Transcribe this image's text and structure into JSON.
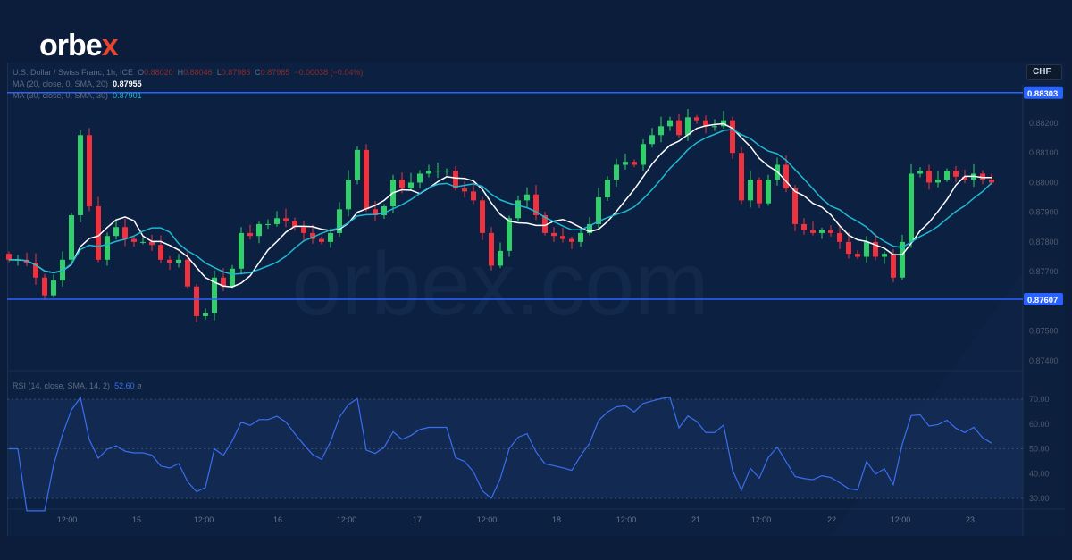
{
  "brand": {
    "logo": "orbex",
    "watermark": "orbex.com"
  },
  "legend": {
    "symbol": "U.S. Dollar / Swiss Franc, 1h, ICE",
    "o_label": "O",
    "o": "0.88020",
    "h_label": "H",
    "h": "0.88046",
    "l_label": "L",
    "l": "0.87985",
    "c_label": "C",
    "c": "0.87985",
    "change": "−0.00038 (−0.04%)",
    "ma20_label": "MA (20, close, 0, SMA, 20)",
    "ma20": "0.87955",
    "ma30_label": "MA (30, close, 0, SMA, 30)",
    "ma30": "0.87901",
    "rsi_label": "RSI (14, close, SMA, 14, 2)",
    "rsi": "52.60",
    "rsi_extra": "ø"
  },
  "currency": "CHF",
  "colors": {
    "up": "#2fd06a",
    "down": "#f0323f",
    "level": "#2962ff",
    "ma20": "#ffffff",
    "ma30": "#1fb8d0",
    "rsi": "#3a6ef0"
  },
  "chart_data": {
    "type": "candlestick",
    "ylim": [
      0.8735,
      0.8834
    ],
    "yticks": [
      "0.88200",
      "0.88100",
      "0.88000",
      "0.87900",
      "0.87800",
      "0.87700",
      "0.87500",
      "0.87400"
    ],
    "levels": [
      {
        "value": 0.88303,
        "label": "0.88303"
      },
      {
        "value": 0.87607,
        "label": "0.87607"
      }
    ],
    "xticks": [
      "12:00",
      "15",
      "12:00",
      "16",
      "12:00",
      "17",
      "12:00",
      "18",
      "12:00",
      "21",
      "12:00",
      "22",
      "12:00",
      "23"
    ],
    "rsi_ticks": [
      "70.00",
      "60.00",
      "50.00",
      "40.00",
      "30.00"
    ],
    "rsi_range": [
      25,
      78
    ],
    "closes": [
      0.8774,
      0.8774,
      0.8773,
      0.8768,
      0.8762,
      0.8767,
      0.8774,
      0.8789,
      0.8816,
      0.8792,
      0.8774,
      0.8782,
      0.8785,
      0.8781,
      0.878,
      0.878,
      0.8779,
      0.8774,
      0.8773,
      0.8774,
      0.8765,
      0.8755,
      0.8756,
      0.8768,
      0.8765,
      0.8771,
      0.8783,
      0.8782,
      0.8786,
      0.8786,
      0.8788,
      0.8787,
      0.8785,
      0.8783,
      0.8781,
      0.878,
      0.8783,
      0.8791,
      0.8801,
      0.8811,
      0.8791,
      0.8789,
      0.8792,
      0.8801,
      0.8798,
      0.88,
      0.8803,
      0.8804,
      0.8804,
      0.8804,
      0.8798,
      0.8797,
      0.8794,
      0.8783,
      0.8772,
      0.8777,
      0.8788,
      0.8794,
      0.8796,
      0.8789,
      0.8783,
      0.8782,
      0.8781,
      0.878,
      0.8783,
      0.8786,
      0.8795,
      0.8801,
      0.8806,
      0.8807,
      0.8806,
      0.8813,
      0.8816,
      0.8819,
      0.8821,
      0.8816,
      0.8822,
      0.8821,
      0.8819,
      0.8819,
      0.8821,
      0.881,
      0.8794,
      0.8801,
      0.8793,
      0.8801,
      0.8806,
      0.8798,
      0.8786,
      0.8784,
      0.8783,
      0.8784,
      0.8783,
      0.878,
      0.8776,
      0.8775,
      0.878,
      0.8775,
      0.8776,
      0.8768,
      0.878,
      0.8803,
      0.8804,
      0.88,
      0.8801,
      0.8804,
      0.8802,
      0.8801,
      0.8803,
      0.8801,
      0.88
    ]
  }
}
